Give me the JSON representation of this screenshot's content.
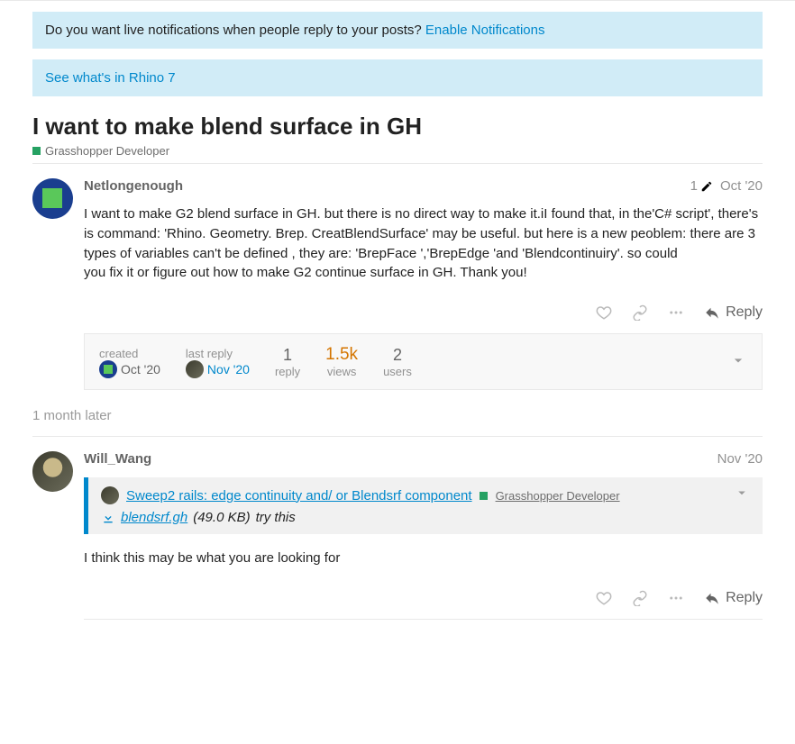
{
  "banners": {
    "notif_text": "Do you want live notifications when people reply to your posts? ",
    "notif_link": "Enable Notifications",
    "rhino7": "See what's in Rhino 7"
  },
  "topic": {
    "title": "I want to make blend surface in GH",
    "category": "Grasshopper Developer"
  },
  "posts": [
    {
      "author": "Netlongenough",
      "date": "Oct '20",
      "edits": "1",
      "content": "I want to make G2 blend surface in GH. but there is no direct way to make it.iI found that, in the'C# script', there's is command: 'Rhino. Geometry. Brep. CreatBlendSurface' may be useful. but here is a new peoblem: there are 3 types of variables can't be defined , they are: 'BrepFace ','BrepEdge 'and 'Blendcontinuiry'. so could\nyou fix it or figure out how to make G2 continue surface in GH. Thank you!"
    },
    {
      "author": "Will_Wang",
      "date": "Nov '20",
      "quote": {
        "link_text": "Sweep2 rails: edge continuity and/ or Blendsrf component",
        "category": "Grasshopper Developer",
        "file_name": "blendsrf.gh",
        "file_size": "(49.0 KB)",
        "file_suffix": " try this"
      },
      "content": "I think this may be what you are looking for"
    }
  ],
  "topic_map": {
    "created_label": "created",
    "created_value": "Oct '20",
    "last_reply_label": "last reply",
    "last_reply_value": "Nov '20",
    "replies_value": "1",
    "replies_label": "reply",
    "views_value": "1.5k",
    "views_label": "views",
    "users_value": "2",
    "users_label": "users"
  },
  "gap": "1 month later",
  "labels": {
    "reply": "Reply"
  }
}
